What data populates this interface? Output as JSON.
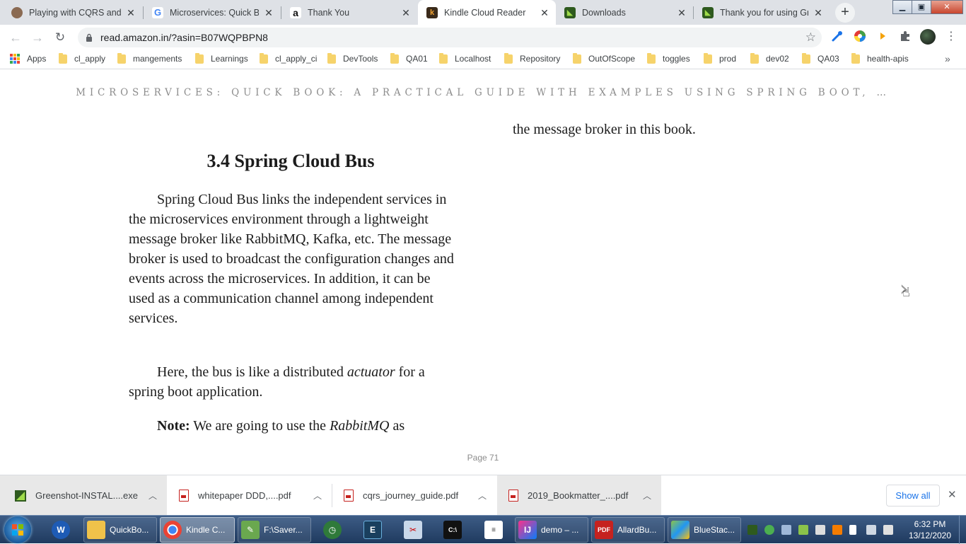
{
  "browser": {
    "tabs": [
      {
        "title": "Playing with CQRS and E",
        "icon": "person-avatar-icon",
        "active": false
      },
      {
        "title": "Microservices: Quick Boo",
        "icon": "google-g-icon",
        "active": false
      },
      {
        "title": "Thank You",
        "icon": "amazon-a-icon",
        "active": false
      },
      {
        "title": "Kindle Cloud Reader",
        "icon": "kindle-k-icon",
        "active": true
      },
      {
        "title": "Downloads",
        "icon": "greenshot-icon",
        "active": false
      },
      {
        "title": "Thank you for using Gree",
        "icon": "greenshot-icon",
        "active": false
      }
    ],
    "new_tab_label": "+",
    "url": "read.amazon.in/?asin=B07WQPBPN8",
    "bookmarks": {
      "apps_label": "Apps",
      "folders": [
        "cl_apply",
        "mangements",
        "Learnings",
        "cl_apply_ci",
        "DevTools",
        "QA01",
        "Localhost",
        "Repository",
        "OutOfScope",
        "toggles",
        "prod",
        "dev02",
        "QA03",
        "health-apis"
      ],
      "overflow_label": "»"
    }
  },
  "reader": {
    "running_head": "MICROSERVICES: QUICK BOOK: A PRACTICAL GUIDE WITH EXAMPLES USING SPRING BOOT, …",
    "right_column_text": "the message broker in this book.",
    "section_heading": "3.4 Spring Cloud Bus",
    "paragraph1": "Spring Cloud Bus links the independent services in the microservices environment through a lightweight message broker like RabbitMQ, Kafka, etc.  The message broker is used to broadcast the configuration changes and events across the microservices. In addition, it can be used as a communication channel among independent services.",
    "paragraph2": {
      "before": "Here, the bus is like a distributed ",
      "emphasis": "actuator",
      "after": " for a spring boot application."
    },
    "paragraph3": {
      "lead": "Note:",
      "before": " We are going to use the ",
      "emphasis": "RabbitMQ",
      "after": " as"
    },
    "page_label": "Page 71",
    "next_icon": "chevron-right-icon"
  },
  "downloads": {
    "items": [
      {
        "name": "Greenshot-INSTAL....exe",
        "type": "exe"
      },
      {
        "name": "whitepaper DDD,....pdf",
        "type": "pdf"
      },
      {
        "name": "cqrs_journey_guide.pdf",
        "type": "pdf"
      },
      {
        "name": "2019_Bookmatter_....pdf",
        "type": "pdf"
      }
    ],
    "show_all_label": "Show all",
    "close_label": "✕"
  },
  "taskbar": {
    "items": [
      {
        "label": "QuickBo...",
        "icon": "folder-icon"
      },
      {
        "label": "Kindle C...",
        "icon": "chrome-icon"
      },
      {
        "label": "F:\\Saver...",
        "icon": "notepad-icon"
      },
      {
        "label": "demo – ...",
        "icon": "intellij-icon"
      },
      {
        "label": "AllardBu...",
        "icon": "pdf-reader-icon"
      },
      {
        "label": "BlueStac...",
        "icon": "bluestacks-icon"
      }
    ],
    "time": "6:32 PM",
    "date": "13/12/2020"
  },
  "colors": {
    "tabstrip_bg": "#dee1e6",
    "link_blue": "#1a73e8",
    "taskbar_top": "#3d5c86",
    "taskbar_bottom": "#1f3a5f"
  }
}
